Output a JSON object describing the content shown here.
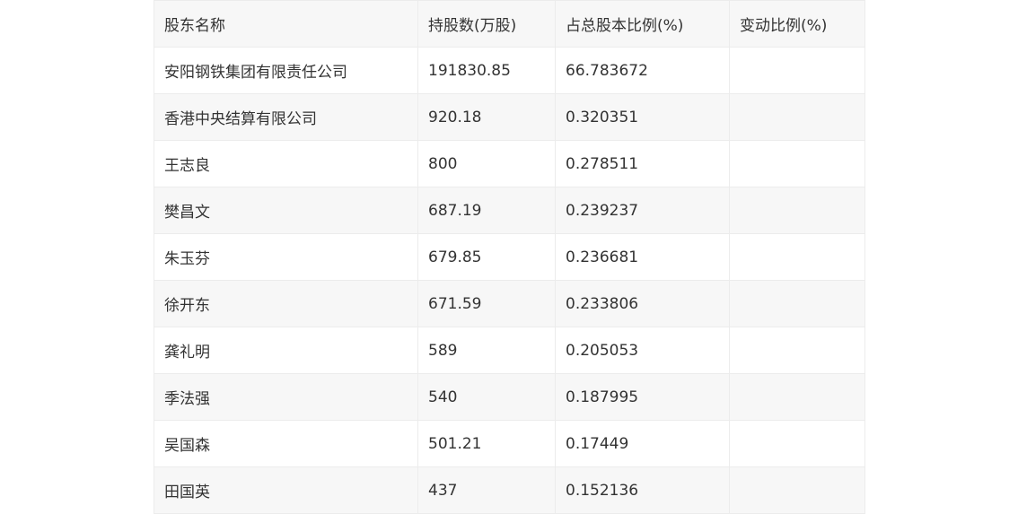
{
  "table": {
    "headers": [
      "股东名称",
      "持股数(万股)",
      "占总股本比例(%)",
      "变动比例(%)"
    ],
    "rows": [
      [
        "安阳钢铁集团有限责任公司",
        "191830.85",
        "66.783672",
        ""
      ],
      [
        "香港中央结算有限公司",
        "920.18",
        "0.320351",
        ""
      ],
      [
        "王志良",
        "800",
        "0.278511",
        ""
      ],
      [
        "樊昌文",
        "687.19",
        "0.239237",
        ""
      ],
      [
        "朱玉芬",
        "679.85",
        "0.236681",
        ""
      ],
      [
        "徐开东",
        "671.59",
        "0.233806",
        ""
      ],
      [
        "龚礼明",
        "589",
        "0.205053",
        ""
      ],
      [
        "季法强",
        "540",
        "0.187995",
        ""
      ],
      [
        "吴国森",
        "501.21",
        "0.17449",
        ""
      ],
      [
        "田国英",
        "437",
        "0.152136",
        ""
      ]
    ]
  }
}
